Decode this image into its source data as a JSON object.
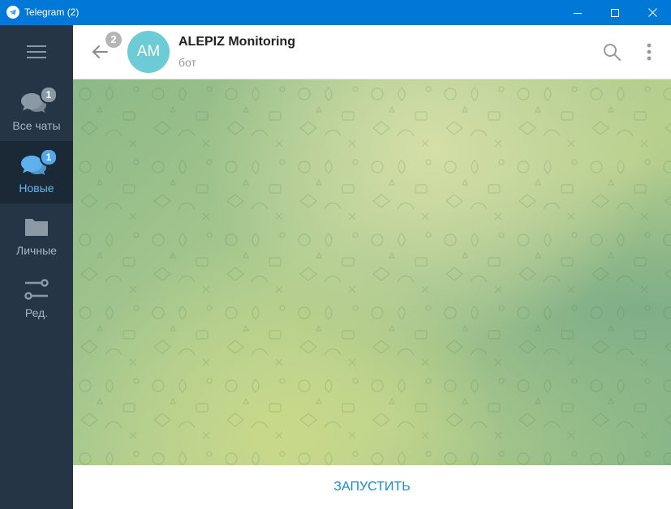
{
  "window": {
    "title": "Telegram (2)"
  },
  "sidebar": {
    "folders": [
      {
        "label": "Все чаты",
        "badge": "1",
        "active": false,
        "icon": "chats-icon"
      },
      {
        "label": "Новые",
        "badge": "1",
        "active": true,
        "icon": "chats-icon"
      },
      {
        "label": "Личные",
        "badge": "",
        "active": false,
        "icon": "folder-icon"
      },
      {
        "label": "Ред.",
        "badge": "",
        "active": false,
        "icon": "edit-folders-icon"
      }
    ]
  },
  "header": {
    "back_badge": "2",
    "avatar_initials": "AM",
    "title": "ALEPIZ Monitoring",
    "subtitle": "бот"
  },
  "bottom": {
    "start_label": "ЗАПУСТИТЬ"
  },
  "colors": {
    "accent": "#168acd",
    "titlebar": "#0078d7",
    "sidebar": "#263545",
    "avatar": "#6ccbd4"
  }
}
